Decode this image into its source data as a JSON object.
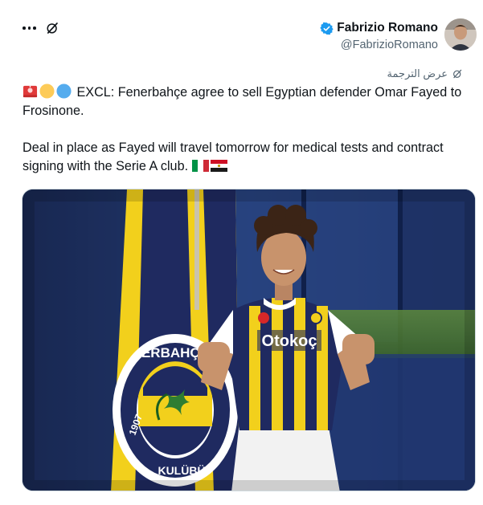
{
  "header": {
    "author_name": "Fabrizio Romano",
    "author_handle": "@FabrizioRomano",
    "verified": true,
    "more_icon": "more-horizontal-icon",
    "grok_icon": "grok-icon"
  },
  "translate": {
    "label": "عرض الترجمة",
    "icon": "grok-translate-icon"
  },
  "tweet": {
    "line1_text": " EXCL: Fenerbahçe agree to sell Egyptian defender Omar Fayed to Frosinone.",
    "line2_text": "Deal in place as Fayed will travel tomorrow for medical tests and contract signing with the Serie A club. ",
    "emojis_start": [
      "siren",
      "yellow-circle",
      "blue-circle"
    ],
    "emojis_end": [
      "italy-flag",
      "egypt-flag"
    ]
  },
  "media": {
    "alt": "Player in Fenerbahçe jersey holding fists next to club flag",
    "shirt_sponsor": "Otokoç",
    "flag_text": "FENERBAHÇE 1907 ★ SPOR KULÜBÜ"
  },
  "colors": {
    "accent": "#1d9bf0",
    "text": "#0f1419",
    "secondary_text": "#536471",
    "fener_navy": "#1f2a60",
    "fener_yellow": "#f2d01c"
  }
}
